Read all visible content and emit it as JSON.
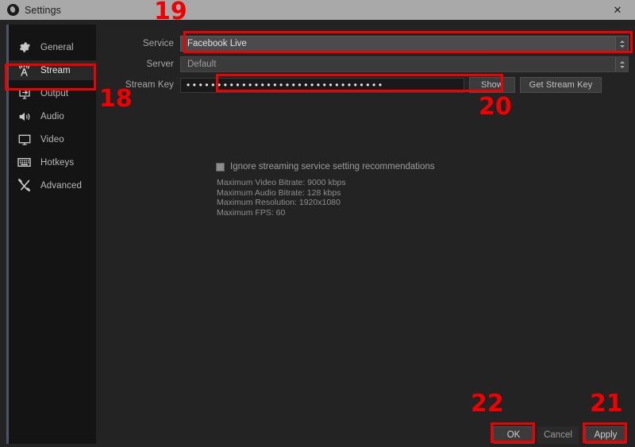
{
  "window": {
    "title": "Settings",
    "logo_icon": "obs-logo-icon",
    "close_icon": "close-icon"
  },
  "sidebar": {
    "items": [
      {
        "label": "General",
        "icon": "gear-icon",
        "selected": false
      },
      {
        "label": "Stream",
        "icon": "broadcast-tower-icon",
        "selected": true
      },
      {
        "label": "Output",
        "icon": "monitor-arrow-icon",
        "selected": false
      },
      {
        "label": "Audio",
        "icon": "speaker-icon",
        "selected": false
      },
      {
        "label": "Video",
        "icon": "display-icon",
        "selected": false
      },
      {
        "label": "Hotkeys",
        "icon": "keyboard-icon",
        "selected": false
      },
      {
        "label": "Advanced",
        "icon": "wrench-screwdriver-icon",
        "selected": false
      }
    ]
  },
  "form": {
    "service": {
      "label": "Service",
      "value": "Facebook Live",
      "spinner_up_icon": "chevron-up-icon",
      "spinner_down_icon": "chevron-down-icon"
    },
    "server": {
      "label": "Server",
      "value": "Default",
      "spinner_up_icon": "chevron-up-icon",
      "spinner_down_icon": "chevron-down-icon"
    },
    "stream_key": {
      "label": "Stream Key",
      "value": "••••••••••••••••••••••••••••••••",
      "show_button": "Show",
      "get_key_button": "Get Stream Key"
    }
  },
  "options": {
    "ignore_recommendations_label": "Ignore streaming service setting recommendations",
    "ignore_recommendations_checked": false,
    "info_lines": [
      "Maximum Video Bitrate: 9000 kbps",
      "Maximum Audio Bitrate: 128 kbps",
      "Maximum Resolution: 1920x1080",
      "Maximum FPS: 60"
    ]
  },
  "footer": {
    "ok": "OK",
    "cancel": "Cancel",
    "apply": "Apply"
  },
  "annotations": {
    "color": "#f00000",
    "numbers": [
      {
        "text": "19",
        "target": "service-field"
      },
      {
        "text": "18",
        "target": "sidebar-item-stream"
      },
      {
        "text": "20",
        "target": "stream-key-field"
      },
      {
        "text": "22",
        "target": "ok-button"
      },
      {
        "text": "21",
        "target": "apply-button"
      }
    ]
  }
}
